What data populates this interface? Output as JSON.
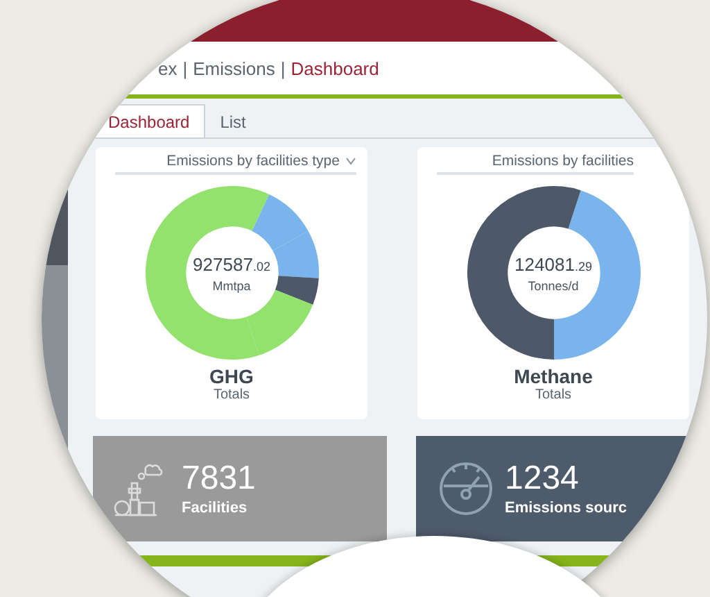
{
  "breadcrumb_separator": "|",
  "breadcrumb": [
    {
      "label": "ex",
      "selected": false
    },
    {
      "label": "Emissions",
      "selected": false
    },
    {
      "label": "Dashboard",
      "selected": true
    }
  ],
  "tabs": [
    {
      "label": "Dashboard",
      "selected": true
    },
    {
      "label": "List",
      "selected": false
    }
  ],
  "cards": [
    {
      "kind": "ghg",
      "selector": "Emissions by facilities type",
      "dropdown": true,
      "value": "927587",
      "decimals": ".02",
      "unit": "Mmtpa",
      "title": "GHG",
      "subtitle": "Totals"
    },
    {
      "kind": "methane",
      "selector": "Emissions by facilities",
      "dropdown": false,
      "value": "124081",
      "decimals": ".29",
      "unit": "Tonnes/d",
      "title": "Methane",
      "subtitle": "Totals"
    }
  ],
  "tiles": [
    {
      "kind": "facilities",
      "value": "7831",
      "label": "Facilities"
    },
    {
      "kind": "sources",
      "value": "1234",
      "label": "Emissions sourc"
    }
  ]
}
